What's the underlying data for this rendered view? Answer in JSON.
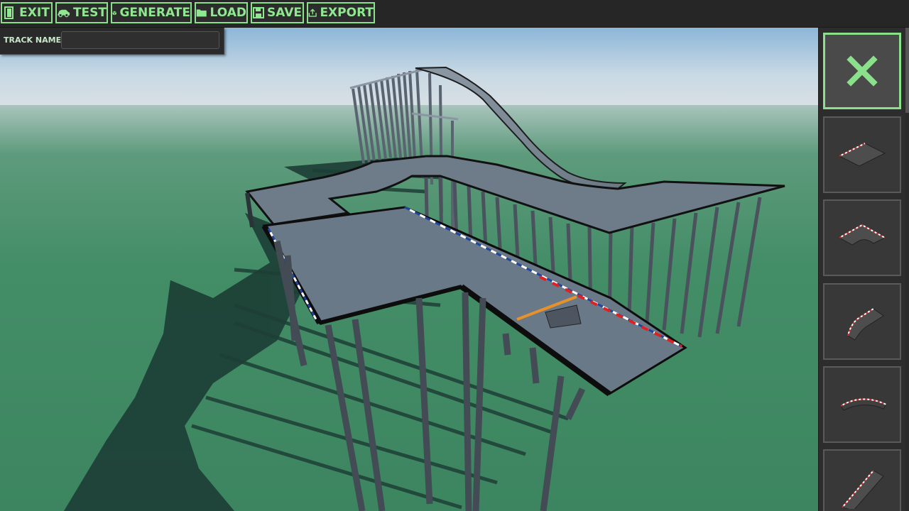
{
  "toolbar": {
    "buttons": [
      {
        "label": "EXIT",
        "icon": "door-exit-icon"
      },
      {
        "label": "TEST",
        "icon": "car-icon"
      },
      {
        "label": "GENERATE",
        "icon": "cube-icon"
      },
      {
        "label": "LOAD",
        "icon": "folder-icon"
      },
      {
        "label": "SAVE",
        "icon": "floppy-disk-icon"
      },
      {
        "label": "EXPORT",
        "icon": "share-export-icon"
      }
    ]
  },
  "track": {
    "name_label": "TRACK NAME:",
    "name_value": "",
    "name_placeholder": ""
  },
  "palette": {
    "items": [
      {
        "piece": "delete",
        "icon": "close-icon",
        "selected": true
      },
      {
        "piece": "straight",
        "icon": "straight-piece-icon",
        "selected": false
      },
      {
        "piece": "curve",
        "icon": "curve-piece-icon",
        "selected": false
      },
      {
        "piece": "ramp",
        "icon": "ramp-piece-icon",
        "selected": false
      },
      {
        "piece": "bank",
        "icon": "bank-piece-icon",
        "selected": false
      },
      {
        "piece": "diagonal",
        "icon": "diagonal-piece-icon",
        "selected": false
      }
    ]
  },
  "colors": {
    "accent": "#8be08b",
    "sky": "#b9d3e6",
    "ground": "#3f8a63",
    "track": "#6b7a8a",
    "rail": "#111111",
    "finish_line": "#e8912a"
  }
}
